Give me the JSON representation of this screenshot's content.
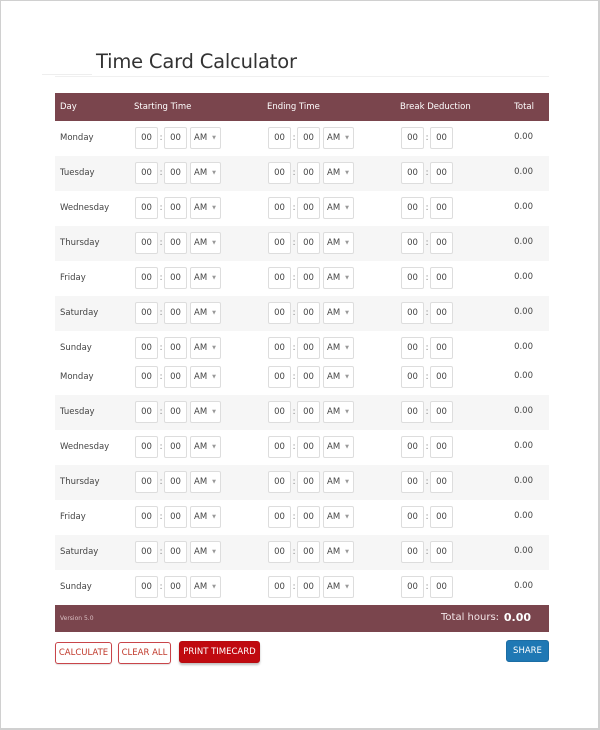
{
  "page": {
    "title": "Time Card Calculator"
  },
  "table": {
    "headers": {
      "day": "Day",
      "start": "Starting Time",
      "end": "Ending Time",
      "break": "Break Deduction",
      "total": "Total"
    },
    "colon": ":",
    "rows": [
      {
        "day": "Monday",
        "start_h": "00",
        "start_m": "00",
        "start_ampm": "AM",
        "end_h": "00",
        "end_m": "00",
        "end_ampm": "AM",
        "break_h": "00",
        "break_m": "00",
        "total": "0.00"
      },
      {
        "day": "Tuesday",
        "start_h": "00",
        "start_m": "00",
        "start_ampm": "AM",
        "end_h": "00",
        "end_m": "00",
        "end_ampm": "AM",
        "break_h": "00",
        "break_m": "00",
        "total": "0.00"
      },
      {
        "day": "Wednesday",
        "start_h": "00",
        "start_m": "00",
        "start_ampm": "AM",
        "end_h": "00",
        "end_m": "00",
        "end_ampm": "AM",
        "break_h": "00",
        "break_m": "00",
        "total": "0.00"
      },
      {
        "day": "Thursday",
        "start_h": "00",
        "start_m": "00",
        "start_ampm": "AM",
        "end_h": "00",
        "end_m": "00",
        "end_ampm": "AM",
        "break_h": "00",
        "break_m": "00",
        "total": "0.00"
      },
      {
        "day": "Friday",
        "start_h": "00",
        "start_m": "00",
        "start_ampm": "AM",
        "end_h": "00",
        "end_m": "00",
        "end_ampm": "AM",
        "break_h": "00",
        "break_m": "00",
        "total": "0.00"
      },
      {
        "day": "Saturday",
        "start_h": "00",
        "start_m": "00",
        "start_ampm": "AM",
        "end_h": "00",
        "end_m": "00",
        "end_ampm": "AM",
        "break_h": "00",
        "break_m": "00",
        "total": "0.00"
      },
      {
        "day": "Sunday",
        "start_h": "00",
        "start_m": "00",
        "start_ampm": "AM",
        "end_h": "00",
        "end_m": "00",
        "end_ampm": "AM",
        "break_h": "00",
        "break_m": "00",
        "total": "0.00"
      },
      {
        "day": "Monday",
        "start_h": "00",
        "start_m": "00",
        "start_ampm": "AM",
        "end_h": "00",
        "end_m": "00",
        "end_ampm": "AM",
        "break_h": "00",
        "break_m": "00",
        "total": "0.00"
      },
      {
        "day": "Tuesday",
        "start_h": "00",
        "start_m": "00",
        "start_ampm": "AM",
        "end_h": "00",
        "end_m": "00",
        "end_ampm": "AM",
        "break_h": "00",
        "break_m": "00",
        "total": "0.00"
      },
      {
        "day": "Wednesday",
        "start_h": "00",
        "start_m": "00",
        "start_ampm": "AM",
        "end_h": "00",
        "end_m": "00",
        "end_ampm": "AM",
        "break_h": "00",
        "break_m": "00",
        "total": "0.00"
      },
      {
        "day": "Thursday",
        "start_h": "00",
        "start_m": "00",
        "start_ampm": "AM",
        "end_h": "00",
        "end_m": "00",
        "end_ampm": "AM",
        "break_h": "00",
        "break_m": "00",
        "total": "0.00"
      },
      {
        "day": "Friday",
        "start_h": "00",
        "start_m": "00",
        "start_ampm": "AM",
        "end_h": "00",
        "end_m": "00",
        "end_ampm": "AM",
        "break_h": "00",
        "break_m": "00",
        "total": "0.00"
      },
      {
        "day": "Saturday",
        "start_h": "00",
        "start_m": "00",
        "start_ampm": "AM",
        "end_h": "00",
        "end_m": "00",
        "end_ampm": "AM",
        "break_h": "00",
        "break_m": "00",
        "total": "0.00"
      },
      {
        "day": "Sunday",
        "start_h": "00",
        "start_m": "00",
        "start_ampm": "AM",
        "end_h": "00",
        "end_m": "00",
        "end_ampm": "AM",
        "break_h": "00",
        "break_m": "00",
        "total": "0.00"
      }
    ],
    "footer": {
      "version": "Version 5.0",
      "total_label": "Total hours:",
      "total_value": "0.00"
    }
  },
  "buttons": {
    "calculate": "CALCULATE",
    "clear_all": "CLEAR ALL",
    "print_timecard": "PRINT TIMECARD",
    "share": "SHARE"
  },
  "icons": {
    "select_caret": "▼"
  },
  "colors": {
    "header_bg": "#7a454d",
    "stripe_bg": "#f6f6f6",
    "primary_red": "#c00a10",
    "share_blue": "#1f78b4"
  }
}
